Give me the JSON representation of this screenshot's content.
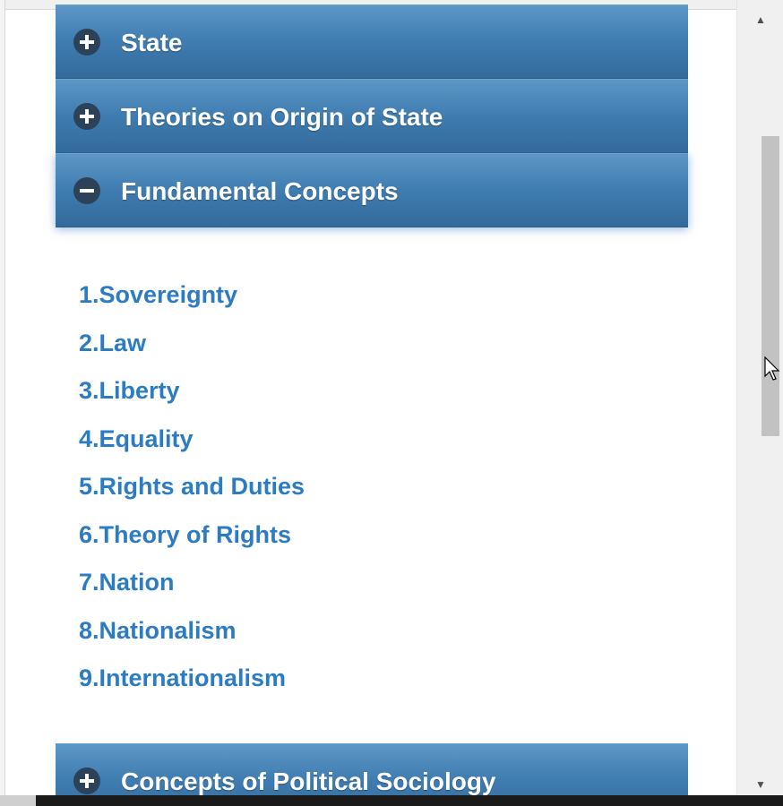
{
  "accordion": {
    "panels": [
      {
        "title": "State",
        "expanded": false
      },
      {
        "title": "Theories on Origin of State",
        "expanded": false
      },
      {
        "title": "Fundamental Concepts",
        "expanded": true
      },
      {
        "title": "Concepts of Political Sociology",
        "expanded": false
      }
    ],
    "topics": [
      "1.Sovereignty",
      "2.Law",
      "3.Liberty",
      "4.Equality",
      "5.Rights and Duties",
      "6.Theory of Rights",
      "7.Nation",
      "8.Nationalism",
      "9.Internationalism"
    ]
  },
  "icons": {
    "expand": "plus-circle-icon",
    "collapse": "minus-circle-icon",
    "scroll_up": "triangle-up-icon",
    "scroll_down": "triangle-down-icon",
    "cursor": "mouse-pointer-icon"
  },
  "colors": {
    "header_gradient_top": "#5c97c6",
    "header_gradient_bottom": "#336a9b",
    "link": "#2c7cc4",
    "icon_circle": "#2c4258"
  }
}
